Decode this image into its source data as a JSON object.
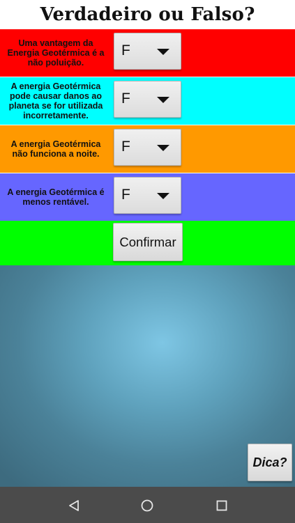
{
  "title": "Verdadeiro ou Falso?",
  "questions": [
    {
      "text": "Uma vantagem da Energia Geotérmica é a não poluição.",
      "selected": "F",
      "color": "#ff0000"
    },
    {
      "text": "A energia Geotérmica pode causar danos ao planeta se for utilizada incorretamente.",
      "selected": "F",
      "color": "#00ffff"
    },
    {
      "text": "A energia Geotérmica não funciona a noite.",
      "selected": "F",
      "color": "#ff9900"
    },
    {
      "text": "A energia Geotérmica é menos rentável.",
      "selected": "F",
      "color": "#6666ff"
    }
  ],
  "confirm": {
    "label": "Confirmar",
    "row_color": "#00ff00"
  },
  "hint": {
    "label": "Dica?"
  },
  "nav": {
    "back": "back-icon",
    "home": "home-icon",
    "recents": "recents-icon",
    "color": "#4b4b4b"
  }
}
